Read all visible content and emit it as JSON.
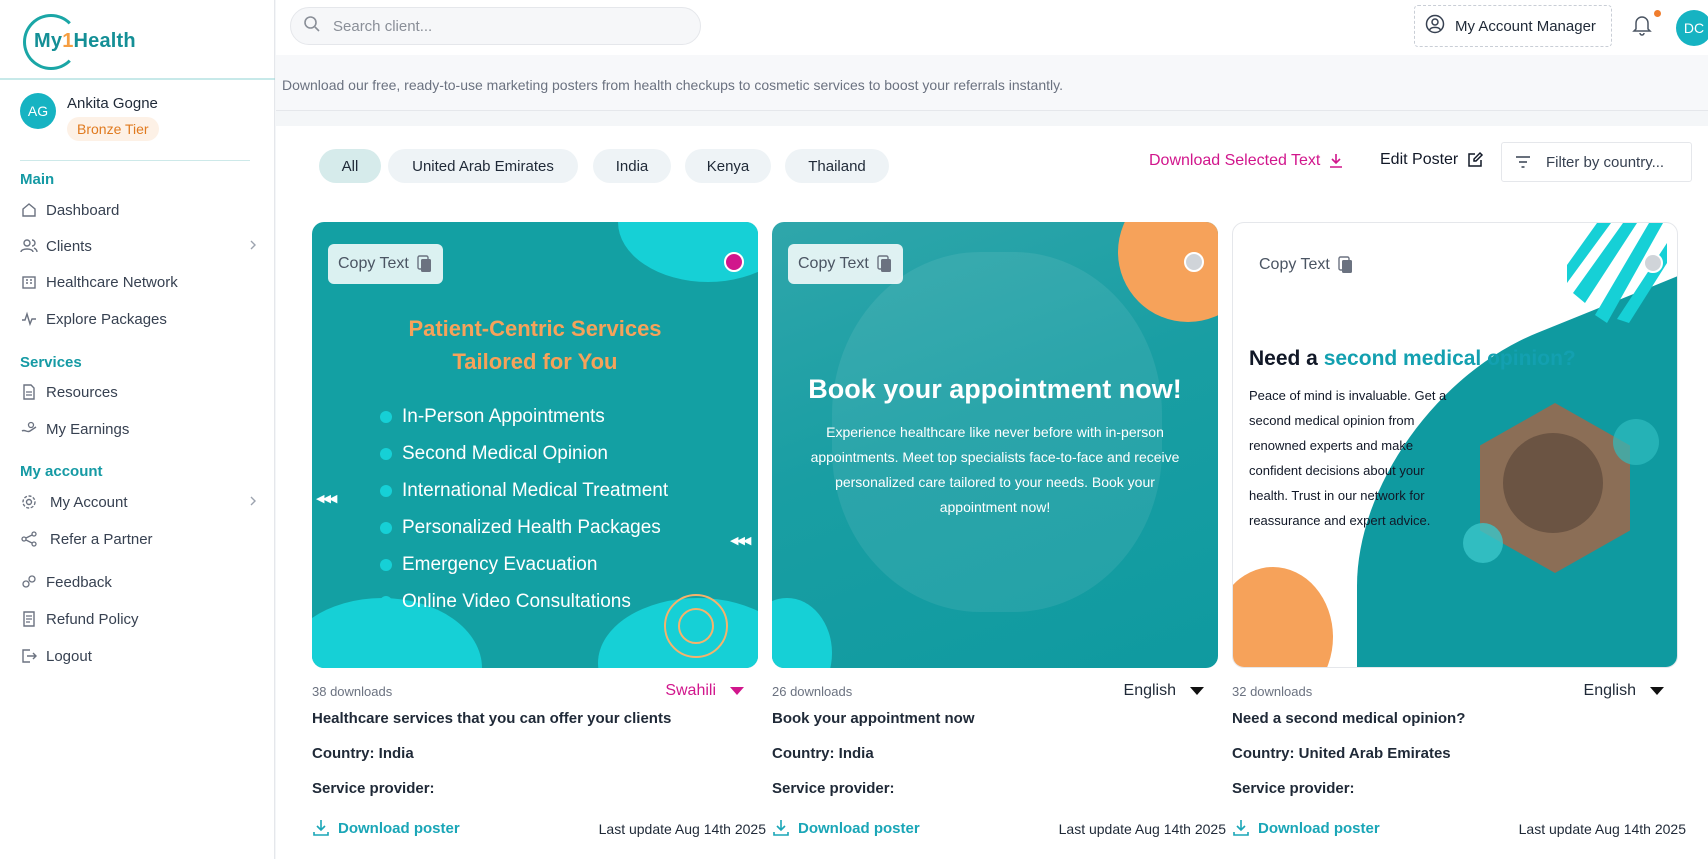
{
  "brand": {
    "logo_prefix": "My",
    "logo_one": "1",
    "logo_suffix": "Health"
  },
  "user": {
    "initials": "AG",
    "name": "Ankita Gogne",
    "tier": "Bronze Tier"
  },
  "sidebar": {
    "sections": [
      "Main",
      "Services",
      "My account"
    ],
    "items": [
      {
        "label": "Dashboard",
        "icon": "home-icon"
      },
      {
        "label": "Clients",
        "icon": "users-icon"
      },
      {
        "label": "Healthcare Network",
        "icon": "building-icon"
      },
      {
        "label": "Explore Packages",
        "icon": "activity-icon"
      },
      {
        "label": "Resources",
        "icon": "document-icon"
      },
      {
        "label": "My Earnings",
        "icon": "earnings-icon"
      },
      {
        "label": "My Account",
        "icon": "gear-icon"
      },
      {
        "label": "Refer a Partner",
        "icon": "share-icon"
      },
      {
        "label": "Feedback",
        "icon": "feedback-icon"
      },
      {
        "label": "Refund Policy",
        "icon": "refund-icon"
      },
      {
        "label": "Logout",
        "icon": "logout-icon"
      }
    ]
  },
  "topbar": {
    "search_placeholder": "Search client...",
    "account_manager": "My Account Manager",
    "avatar_initials": "DC"
  },
  "page": {
    "description": "Download our free, ready-to-use marketing posters from health checkups to cosmetic services to boost your referrals instantly."
  },
  "filters": {
    "chips": [
      "All",
      "United Arab Emirates",
      "India",
      "Kenya",
      "Thailand"
    ],
    "active": "All",
    "download_selected": "Download Selected Text",
    "edit_poster": "Edit Poster",
    "country_placeholder": "Filter by country..."
  },
  "cards": [
    {
      "copy_label": "Copy Text",
      "selected": true,
      "downloads": "38 downloads",
      "language": "Swahili",
      "title": "Healthcare services that you can offer your clients",
      "country": "Country: India",
      "provider": "Service provider:",
      "download_label": "Download poster",
      "last_update": "Last update Aug 14th 2025",
      "poster": {
        "heading_line1": "Patient-Centric Services",
        "heading_line2": "Tailored for You",
        "bullets": [
          "In-Person Appointments",
          "Second Medical Opinion",
          "International Medical Treatment",
          "Personalized Health Packages",
          "Emergency Evacuation",
          "Online Video Consultations"
        ]
      }
    },
    {
      "copy_label": "Copy Text",
      "selected": false,
      "downloads": "26 downloads",
      "language": "English",
      "title": "Book your appointment now",
      "country": "Country: India",
      "provider": "Service provider:",
      "download_label": "Download poster",
      "last_update": "Last update Aug 14th 2025",
      "poster": {
        "heading": "Book your appointment now!",
        "body": "Experience healthcare like never before with in-person appointments. Meet top specialists face-to-face and receive personalized care tailored to your needs. Book your appointment now!"
      }
    },
    {
      "copy_label": "Copy Text",
      "selected": false,
      "downloads": "32 downloads",
      "language": "English",
      "title": "Need a second medical opinion?",
      "country": "Country: United Arab Emirates",
      "provider": "Service provider:",
      "download_label": "Download poster",
      "last_update": "Last update Aug 14th 2025",
      "poster": {
        "heading_plain": "Need a ",
        "heading_highlight": "second medical opinion?",
        "body": "Peace of mind is invaluable. Get a second medical opinion from renowned experts and make confident decisions about your health. Trust in our network for reassurance and expert advice."
      }
    }
  ],
  "colors": {
    "teal": "#13a0a3",
    "accent_pink": "#d1168c",
    "orange": "#f6a25a",
    "link_teal": "#1aa6b7"
  }
}
